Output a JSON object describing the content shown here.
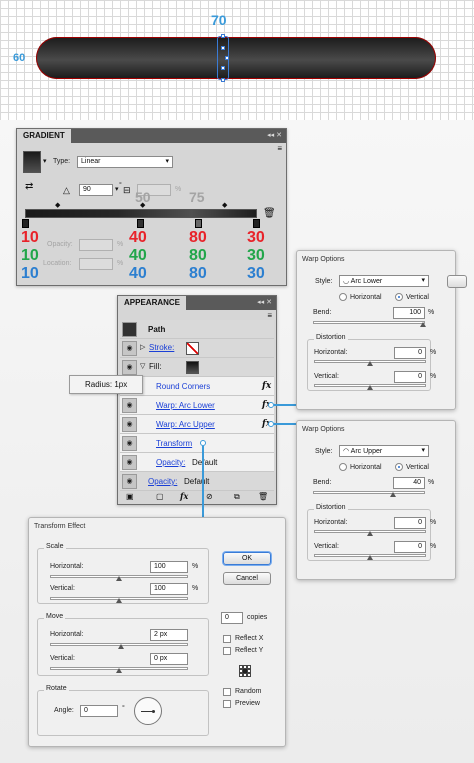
{
  "canvas": {
    "width_label": "70",
    "height_label": "60"
  },
  "gradient_panel": {
    "tab": "GRADIENT",
    "collapse_icon": "double-chevron-left",
    "type_label": "Type:",
    "type_value": "Linear",
    "angle_value": "90",
    "angle_unit": "°",
    "aspect_unit": "%",
    "midpoint_labels": [
      "50",
      "75"
    ],
    "opacity_label": "Opacity:",
    "opacity_unit": "%",
    "location_label": "Location:",
    "location_unit": "%",
    "stops": [
      {
        "r": "10",
        "g": "10",
        "b": "10"
      },
      {
        "r": "40",
        "g": "40",
        "b": "40"
      },
      {
        "r": "80",
        "g": "80",
        "b": "80"
      },
      {
        "r": "30",
        "g": "30",
        "b": "30"
      }
    ]
  },
  "appearance_panel": {
    "tab": "APPEARANCE",
    "path_label": "Path",
    "stroke_label": "Stroke:",
    "fill_label": "Fill:",
    "effects": [
      {
        "label": "Round Corners"
      },
      {
        "label": "Warp: Arc Lower"
      },
      {
        "label": "Warp: Arc Upper"
      },
      {
        "label": "Transform"
      }
    ],
    "fill_opacity_label": "Opacity:",
    "fill_opacity_value": "Default",
    "path_opacity_label": "Opacity:",
    "path_opacity_value": "Default",
    "fx_glyph": "fx"
  },
  "radius_tooltip": "Radius: 1px",
  "warp1": {
    "title": "Warp Options",
    "style_label": "Style:",
    "style_value": "Arc Lower",
    "horizontal": "Horizontal",
    "vertical": "Vertical",
    "bend_label": "Bend:",
    "bend_value": "100",
    "distortion_label": "Distortion",
    "dist_h_label": "Horizontal:",
    "dist_h_value": "0",
    "dist_v_label": "Vertical:",
    "dist_v_value": "0",
    "unit": "%"
  },
  "warp2": {
    "title": "Warp Options",
    "style_label": "Style:",
    "style_value": "Arc Upper",
    "horizontal": "Horizontal",
    "vertical": "Vertical",
    "bend_label": "Bend:",
    "bend_value": "40",
    "distortion_label": "Distortion",
    "dist_h_label": "Horizontal:",
    "dist_h_value": "0",
    "dist_v_label": "Vertical:",
    "dist_v_value": "0",
    "unit": "%"
  },
  "transform": {
    "title": "Transform Effect",
    "scale_label": "Scale",
    "scale_h_label": "Horizontal:",
    "scale_h_value": "100",
    "scale_v_label": "Vertical:",
    "scale_v_value": "100",
    "percent": "%",
    "move_label": "Move",
    "move_h_label": "Horizontal:",
    "move_h_value": "2 px",
    "move_v_label": "Vertical:",
    "move_v_value": "0 px",
    "rotate_label": "Rotate",
    "angle_label": "Angle:",
    "angle_value": "0",
    "degree": "°",
    "ok": "OK",
    "cancel": "Cancel",
    "copies_value": "0",
    "copies_label": "copies",
    "reflect_x": "Reflect X",
    "reflect_y": "Reflect Y",
    "random": "Random",
    "preview": "Preview"
  },
  "colors": {
    "red": "#e8232a",
    "green": "#22a64a",
    "blue": "#2c7fd0",
    "link": "#1a3fd6",
    "accent": "#3a9ad9"
  }
}
